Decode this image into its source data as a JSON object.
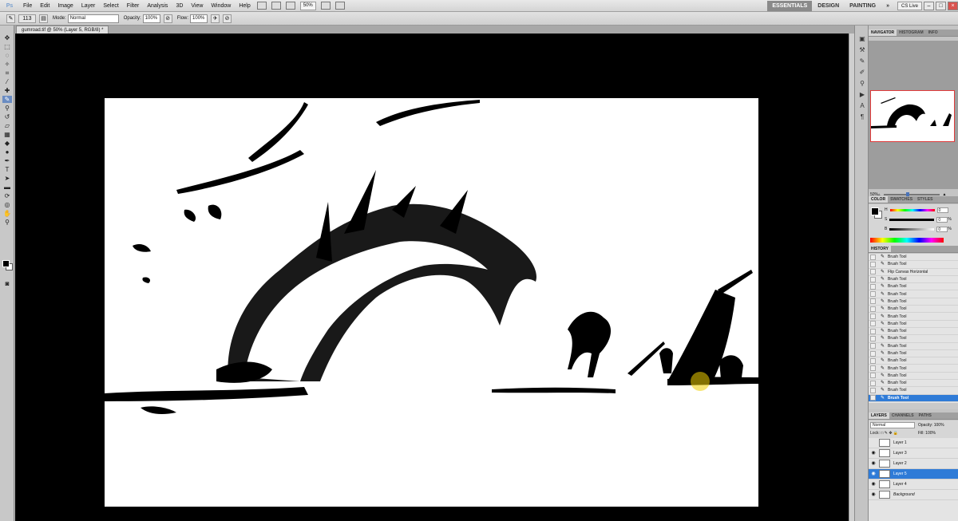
{
  "menubar": {
    "logo": "Ps",
    "items": [
      "File",
      "Edit",
      "Image",
      "Layer",
      "Select",
      "Filter",
      "Analysis",
      "3D",
      "View",
      "Window",
      "Help"
    ],
    "zoom": "50%",
    "workspaces": [
      "ESSENTIALS",
      "DESIGN",
      "PAINTING"
    ],
    "cslive": "CS Live"
  },
  "options": {
    "brush_size": "113",
    "mode_label": "Mode:",
    "mode_value": "Normal",
    "opacity_label": "Opacity:",
    "opacity_value": "100%",
    "flow_label": "Flow:",
    "flow_value": "100%"
  },
  "document": {
    "tab_title": "gumroad.tif @ 50% (Layer 5, RGB/8) *"
  },
  "navigator": {
    "tabs": [
      "NAVIGATOR",
      "HISTOGRAM",
      "INFO"
    ],
    "zoom": "50%"
  },
  "color": {
    "tabs": [
      "COLOR",
      "SWATCHES",
      "STYLES"
    ],
    "rows": [
      {
        "label": "H",
        "value": "0",
        "unit": ""
      },
      {
        "label": "S",
        "value": "0",
        "unit": "%"
      },
      {
        "label": "B",
        "value": "0",
        "unit": "%"
      }
    ]
  },
  "history": {
    "title": "HISTORY",
    "items": [
      "Brush Tool",
      "Brush Tool",
      "Flip Canvas Horizontal",
      "Brush Tool",
      "Brush Tool",
      "Brush Tool",
      "Brush Tool",
      "Brush Tool",
      "Brush Tool",
      "Brush Tool",
      "Brush Tool",
      "Brush Tool",
      "Brush Tool",
      "Brush Tool",
      "Brush Tool",
      "Brush Tool",
      "Brush Tool",
      "Brush Tool",
      "Brush Tool",
      "Brush Tool"
    ],
    "active_index": 19
  },
  "layers": {
    "tabs": [
      "LAYERS",
      "CHANNELS",
      "PATHS"
    ],
    "blend_mode": "Normal",
    "opacity_label": "Opacity:",
    "opacity_value": "100%",
    "lock_label": "Lock:",
    "fill_label": "Fill:",
    "fill_value": "100%",
    "items": [
      {
        "name": "Layer 1",
        "visible": false
      },
      {
        "name": "Layer 3",
        "visible": true
      },
      {
        "name": "Layer 2",
        "visible": true
      },
      {
        "name": "Layer 5",
        "visible": true,
        "active": true
      },
      {
        "name": "Layer 4",
        "visible": true
      },
      {
        "name": "Background",
        "visible": true
      }
    ]
  },
  "colors": {
    "selection": "#2f7bd7",
    "canvas_bg": "#000000",
    "artboard": "#ffffff"
  }
}
